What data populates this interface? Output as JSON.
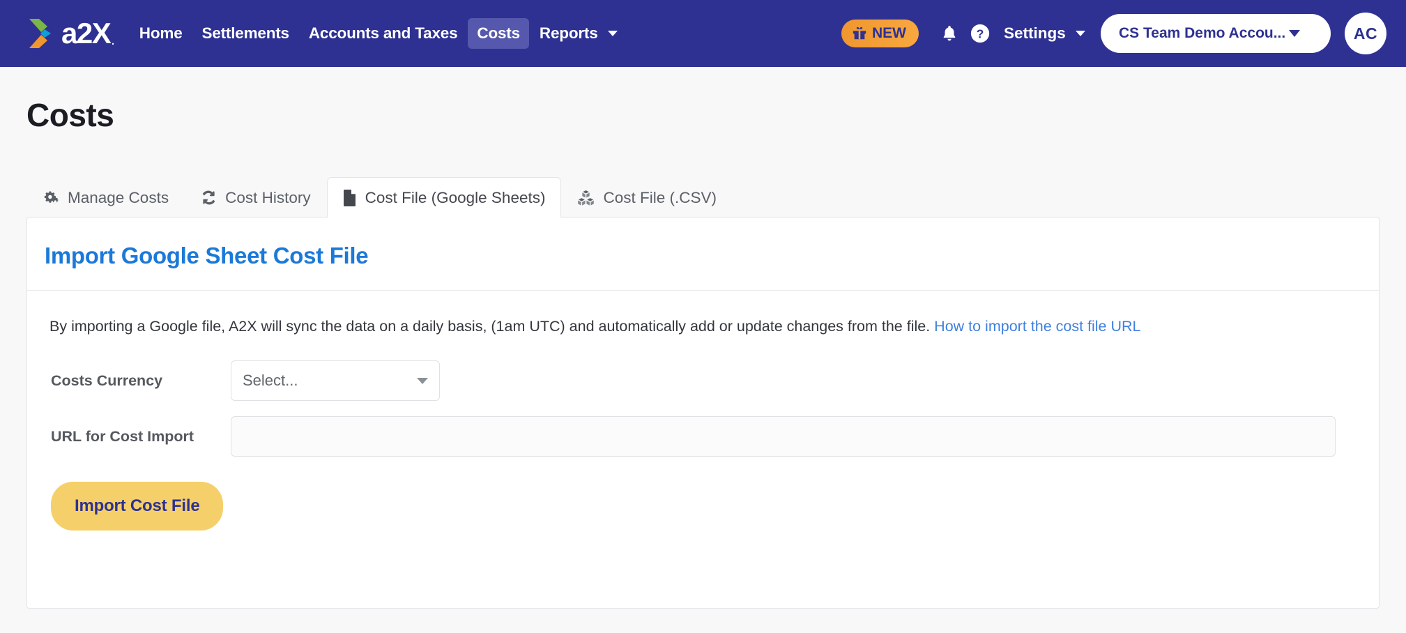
{
  "header": {
    "logo_text": "a2X",
    "logo_icon": "a2x-chevron-logo",
    "nav_links": [
      {
        "label": "Home",
        "active": false,
        "has_caret": false
      },
      {
        "label": "Settlements",
        "active": false,
        "has_caret": false
      },
      {
        "label": "Accounts and Taxes",
        "active": false,
        "has_caret": false
      },
      {
        "label": "Costs",
        "active": true,
        "has_caret": false
      },
      {
        "label": "Reports",
        "active": false,
        "has_caret": true
      }
    ],
    "new_badge": {
      "label": "NEW",
      "icon": "gift-icon",
      "bg_start": "#f0962f",
      "bg_end": "#f8a83f"
    },
    "notifications_icon": "bell-icon",
    "help_icon": "question-circle-icon",
    "settings_label": "Settings",
    "settings_icon": "chevron-down-icon",
    "account_name": "CS Team Demo Accou...",
    "account_caret_icon": "caret-down-icon",
    "avatar_initials": "AC",
    "bg_color": "#2e3192",
    "active_pill_color": "#5558ac"
  },
  "page": {
    "title": "Costs",
    "bg_color": "#f8f8f9"
  },
  "tabs": [
    {
      "label": "Manage Costs",
      "icon": "cogs-icon",
      "active": false
    },
    {
      "label": "Cost History",
      "icon": "sync-refresh-icon",
      "active": false
    },
    {
      "label": "Cost File (Google Sheets)",
      "icon": "file-icon",
      "active": true
    },
    {
      "label": "Cost File (.CSV)",
      "icon": "cubes-icon",
      "active": false
    }
  ],
  "card": {
    "title": "Import Google Sheet Cost File",
    "title_color": "#1b79d8",
    "intro_text": "By importing a Google file, A2X will sync the data on a daily basis, (1am UTC) and automatically add or update changes from the file.",
    "intro_link": "How to import the cost file URL",
    "intro_link_color": "#3f7fe0",
    "currency": {
      "label": "Costs Currency",
      "value": "Select...",
      "caret_icon": "caret-down-icon"
    },
    "url": {
      "label": "URL for Cost Import",
      "value": "",
      "placeholder": ""
    },
    "submit_label": "Import Cost File",
    "submit_bg": "#f5d06a",
    "submit_color": "#2e3192"
  }
}
